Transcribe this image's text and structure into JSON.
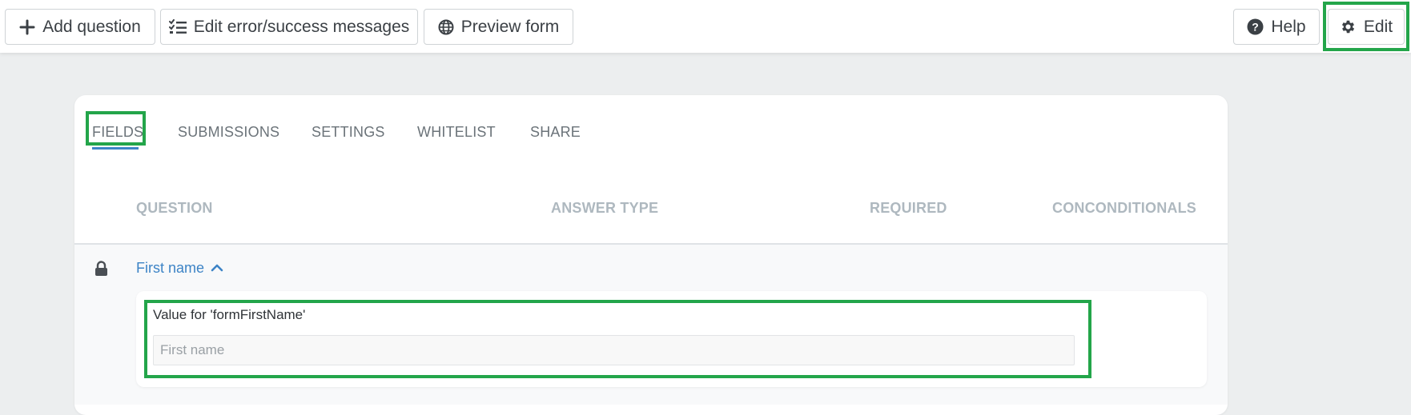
{
  "toolbar": {
    "add_question": "Add question",
    "edit_messages": "Edit error/success messages",
    "preview_form": "Preview form",
    "help": "Help",
    "edit": "Edit"
  },
  "tabs": [
    "FIELDS",
    "SUBMISSIONS",
    "SETTINGS",
    "WHITELIST",
    "SHARE"
  ],
  "columns": [
    "QUESTION",
    "ANSWER TYPE",
    "REQUIRED",
    "CONCONDITIONALS"
  ],
  "question": {
    "title": "First name",
    "value_label": "Value for 'formFirstName'",
    "input_placeholder": "First name",
    "input_value": ""
  },
  "colors": {
    "accent": "#3d84c6",
    "highlight": "#23a54a",
    "page_bg": "#eceeef"
  },
  "icons": [
    "plus-icon",
    "checklist-icon",
    "globe-icon",
    "question-circle-icon",
    "gear-icon",
    "lock-icon",
    "chevron-up-icon"
  ]
}
